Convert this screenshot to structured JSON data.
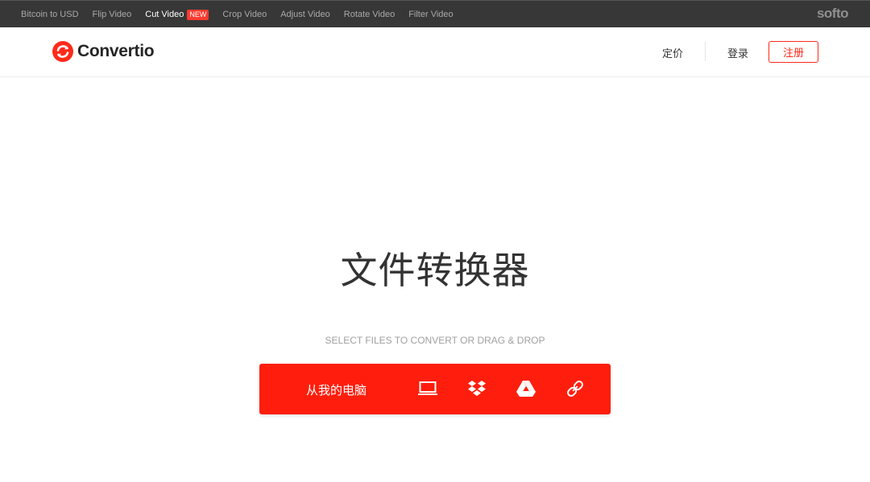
{
  "topbar": {
    "links": [
      {
        "label": "Bitcoin to USD"
      },
      {
        "label": "Flip Video"
      },
      {
        "label": "Cut Video",
        "badge": "NEW"
      },
      {
        "label": "Crop Video"
      },
      {
        "label": "Adjust Video"
      },
      {
        "label": "Rotate Video"
      },
      {
        "label": "Filter Video"
      }
    ],
    "brand": "softo"
  },
  "header": {
    "logo_text": "Convertio",
    "nav": {
      "pricing": "定价",
      "login": "登录",
      "signup": "注册"
    }
  },
  "hero": {
    "title": "文件转换器",
    "subtitle": "SELECT FILES TO CONVERT OR DRAG & DROP"
  },
  "upload": {
    "label": "从我的电脑",
    "icons": [
      "computer-icon",
      "dropbox-icon",
      "google-drive-icon",
      "url-link-icon"
    ]
  },
  "colors": {
    "accent": "#ff1e0d",
    "topbar": "#373737"
  }
}
